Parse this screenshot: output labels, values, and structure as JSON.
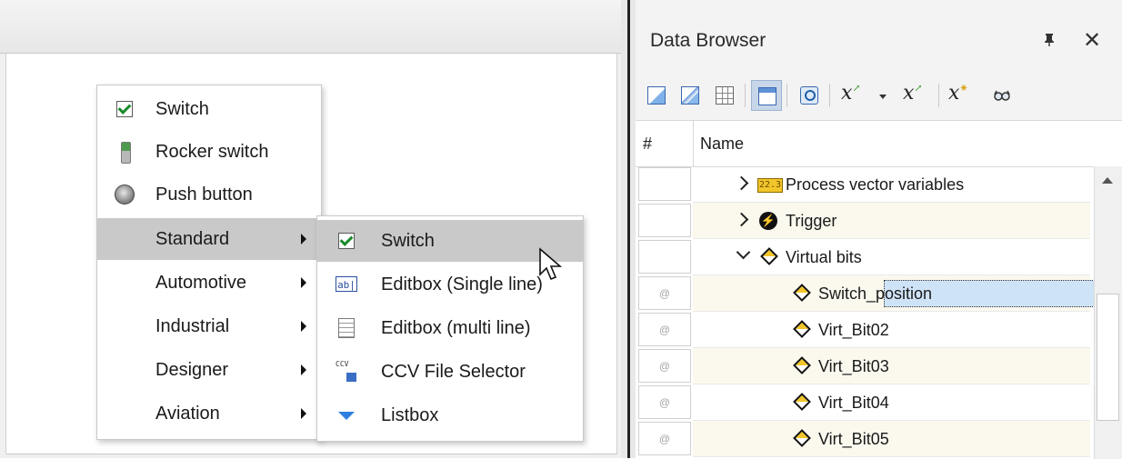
{
  "context_menu": {
    "items": [
      {
        "label": "Switch",
        "icon": "checkbox-checked-icon"
      },
      {
        "label": "Rocker switch",
        "icon": "rocker-switch-icon"
      },
      {
        "label": "Push button",
        "icon": "push-button-icon"
      },
      {
        "label": "Standard",
        "icon": "",
        "submenu": true,
        "highlighted": true
      },
      {
        "label": "Automotive",
        "icon": "",
        "submenu": true
      },
      {
        "label": "Industrial",
        "icon": "",
        "submenu": true
      },
      {
        "label": "Designer",
        "icon": "",
        "submenu": true
      },
      {
        "label": "Aviation",
        "icon": "",
        "submenu": true
      }
    ]
  },
  "submenu": {
    "items": [
      {
        "label": "Switch",
        "icon": "checkbox-checked-icon",
        "highlighted": true
      },
      {
        "label": "Editbox (Single line)",
        "icon": "editbox-single-icon",
        "icon_text": "ab|"
      },
      {
        "label": "Editbox (multi line)",
        "icon": "editbox-multi-icon"
      },
      {
        "label": "CCV File Selector",
        "icon": "ccv-file-icon",
        "icon_text": "CCV"
      },
      {
        "label": "Listbox",
        "icon": "listbox-icon"
      }
    ]
  },
  "data_browser": {
    "title": "Data Browser",
    "pin_glyph": "📌",
    "close_glyph": "✕",
    "toolbar": [
      {
        "icon": "curve-window-icon"
      },
      {
        "icon": "curve-window-multi-icon"
      },
      {
        "icon": "table-icon"
      },
      {
        "icon": "view-icon",
        "active": true
      },
      {
        "icon": "search-icon"
      },
      {
        "icon": "formula-add-icon",
        "text": "x",
        "dropdown": true
      },
      {
        "icon": "formula-edit-icon",
        "text": "x"
      },
      {
        "icon": "formula-new-icon",
        "text": "x"
      },
      {
        "icon": "glasses-icon"
      }
    ],
    "columns": {
      "number": "#",
      "name": "Name"
    },
    "rows": [
      {
        "label": "Process vector variables",
        "expander": "collapsed",
        "icon": "process-vector-icon",
        "icon_text": "22.3",
        "number": ""
      },
      {
        "label": "Trigger",
        "expander": "collapsed",
        "icon": "trigger-icon",
        "icon_text": "⚡",
        "number": ""
      },
      {
        "label": "Virtual bits",
        "expander": "expanded",
        "icon": "virtual-bit-icon",
        "number": ""
      },
      {
        "label": "Switch_position",
        "icon": "virtual-bit-icon",
        "number": "@",
        "selected": true
      },
      {
        "label": "Virt_Bit02",
        "icon": "virtual-bit-icon",
        "number": "@"
      },
      {
        "label": "Virt_Bit03",
        "icon": "virtual-bit-icon",
        "number": "@"
      },
      {
        "label": "Virt_Bit04",
        "icon": "virtual-bit-icon",
        "number": "@"
      },
      {
        "label": "Virt_Bit05",
        "icon": "virtual-bit-icon",
        "number": "@"
      }
    ]
  },
  "colors": {
    "menu_highlight": "#c9c9c9",
    "selection": "#cfe3f7",
    "toolbar_active": "#c7d6e8",
    "bit_yellow": "#f2c62a"
  }
}
